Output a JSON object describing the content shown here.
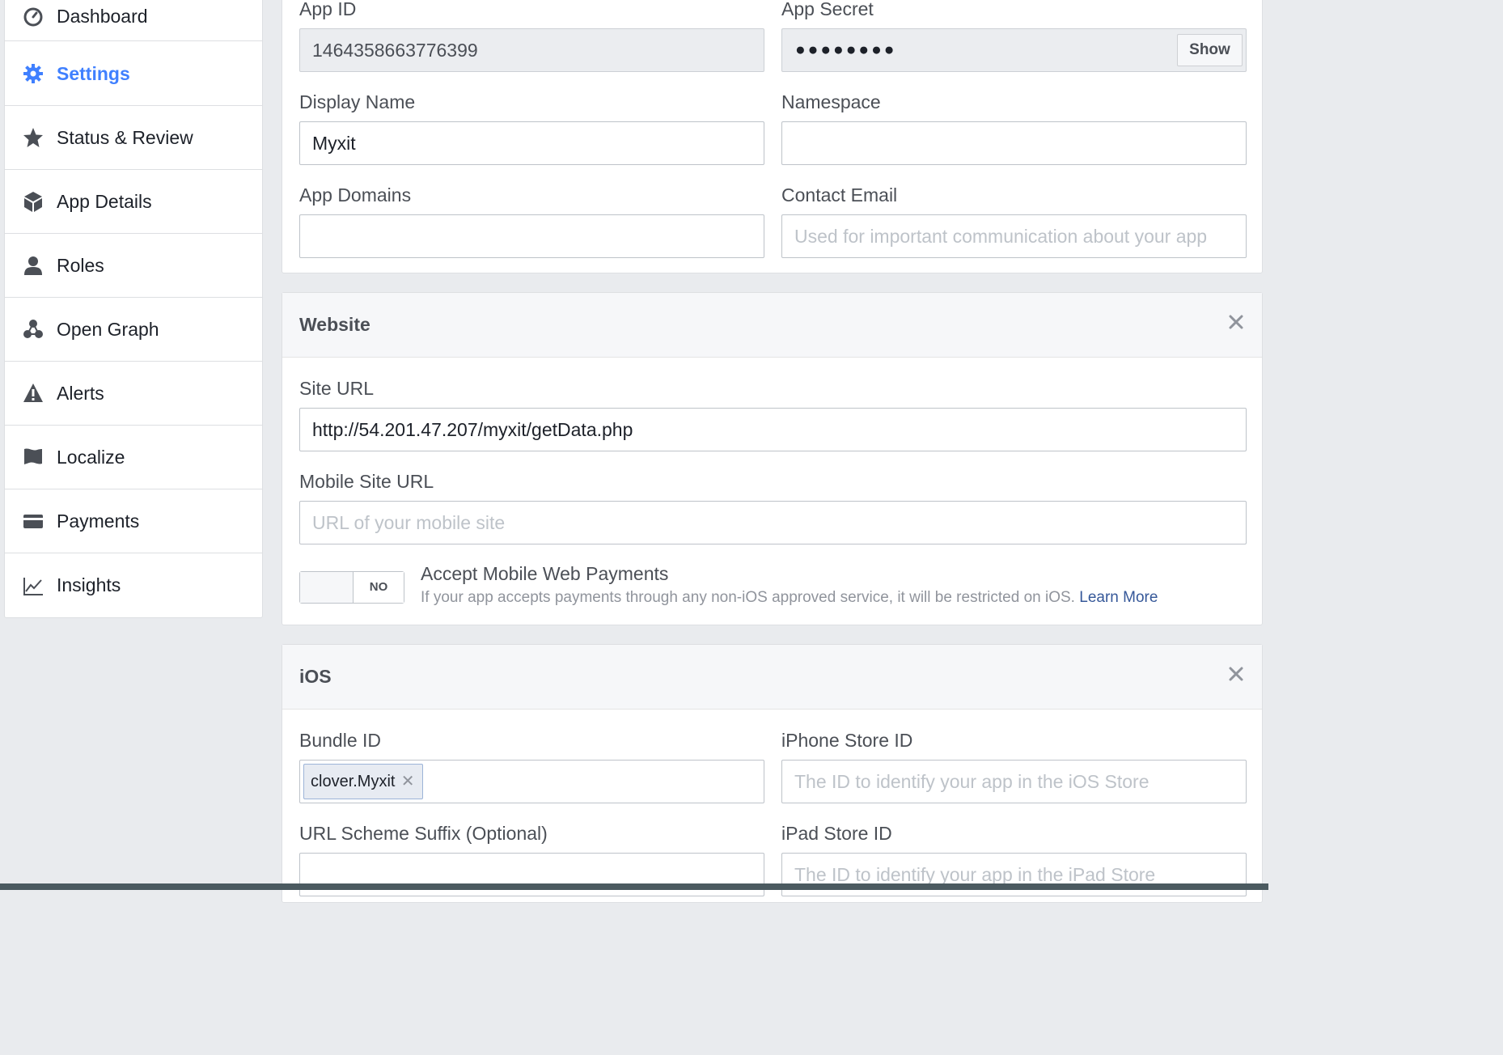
{
  "sidebar": {
    "items": [
      {
        "label": "Dashboard",
        "icon": "dashboard-icon"
      },
      {
        "label": "Settings",
        "icon": "gear-icon",
        "active": true
      },
      {
        "label": "Status & Review",
        "icon": "star-icon"
      },
      {
        "label": "App Details",
        "icon": "cube-icon"
      },
      {
        "label": "Roles",
        "icon": "person-icon"
      },
      {
        "label": "Open Graph",
        "icon": "open-graph-icon"
      },
      {
        "label": "Alerts",
        "icon": "warning-icon"
      },
      {
        "label": "Localize",
        "icon": "flag-icon"
      },
      {
        "label": "Payments",
        "icon": "credit-card-icon"
      },
      {
        "label": "Insights",
        "icon": "chart-icon"
      }
    ]
  },
  "basic": {
    "app_id_label": "App ID",
    "app_id_value": "1464358663776399",
    "app_secret_label": "App Secret",
    "app_secret_value": "●●●●●●●●",
    "show_label": "Show",
    "display_name_label": "Display Name",
    "display_name_value": "Myxit",
    "namespace_label": "Namespace",
    "namespace_value": "",
    "app_domains_label": "App Domains",
    "app_domains_value": "",
    "contact_email_label": "Contact Email",
    "contact_email_placeholder": "Used for important communication about your app"
  },
  "website": {
    "title": "Website",
    "site_url_label": "Site URL",
    "site_url_value": "http://54.201.47.207/myxit/getData.php",
    "mobile_site_url_label": "Mobile Site URL",
    "mobile_site_url_placeholder": "URL of your mobile site",
    "toggle_state": "NO",
    "payments_title": "Accept Mobile Web Payments",
    "payments_desc": "If your app accepts payments through any non-iOS approved service, it will be restricted on iOS.",
    "learn_more": "Learn More"
  },
  "ios": {
    "title": "iOS",
    "bundle_id_label": "Bundle ID",
    "bundle_id_tag": "clover.Myxit",
    "iphone_store_label": "iPhone Store ID",
    "iphone_store_placeholder": "The ID to identify your app in the iOS Store",
    "url_scheme_label": "URL Scheme Suffix (Optional)",
    "ipad_store_label": "iPad Store ID",
    "ipad_store_placeholder": "The ID to identify your app in the iPad Store"
  },
  "colors": {
    "accent": "#4080ff",
    "link": "#365899",
    "background": "#e9ebee"
  }
}
